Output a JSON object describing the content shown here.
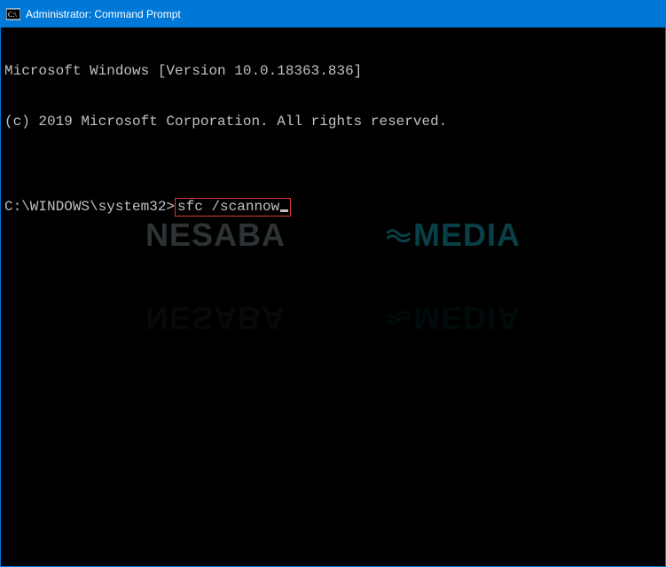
{
  "window": {
    "title": "Administrator: Command Prompt"
  },
  "terminal": {
    "line1": "Microsoft Windows [Version 10.0.18363.836]",
    "line2": "(c) 2019 Microsoft Corporation. All rights reserved.",
    "blank": "",
    "prompt": "C:\\WINDOWS\\system32>",
    "command": "sfc /scannow"
  },
  "watermark": {
    "part1": "NESABA",
    "part2": "MEDIA"
  }
}
